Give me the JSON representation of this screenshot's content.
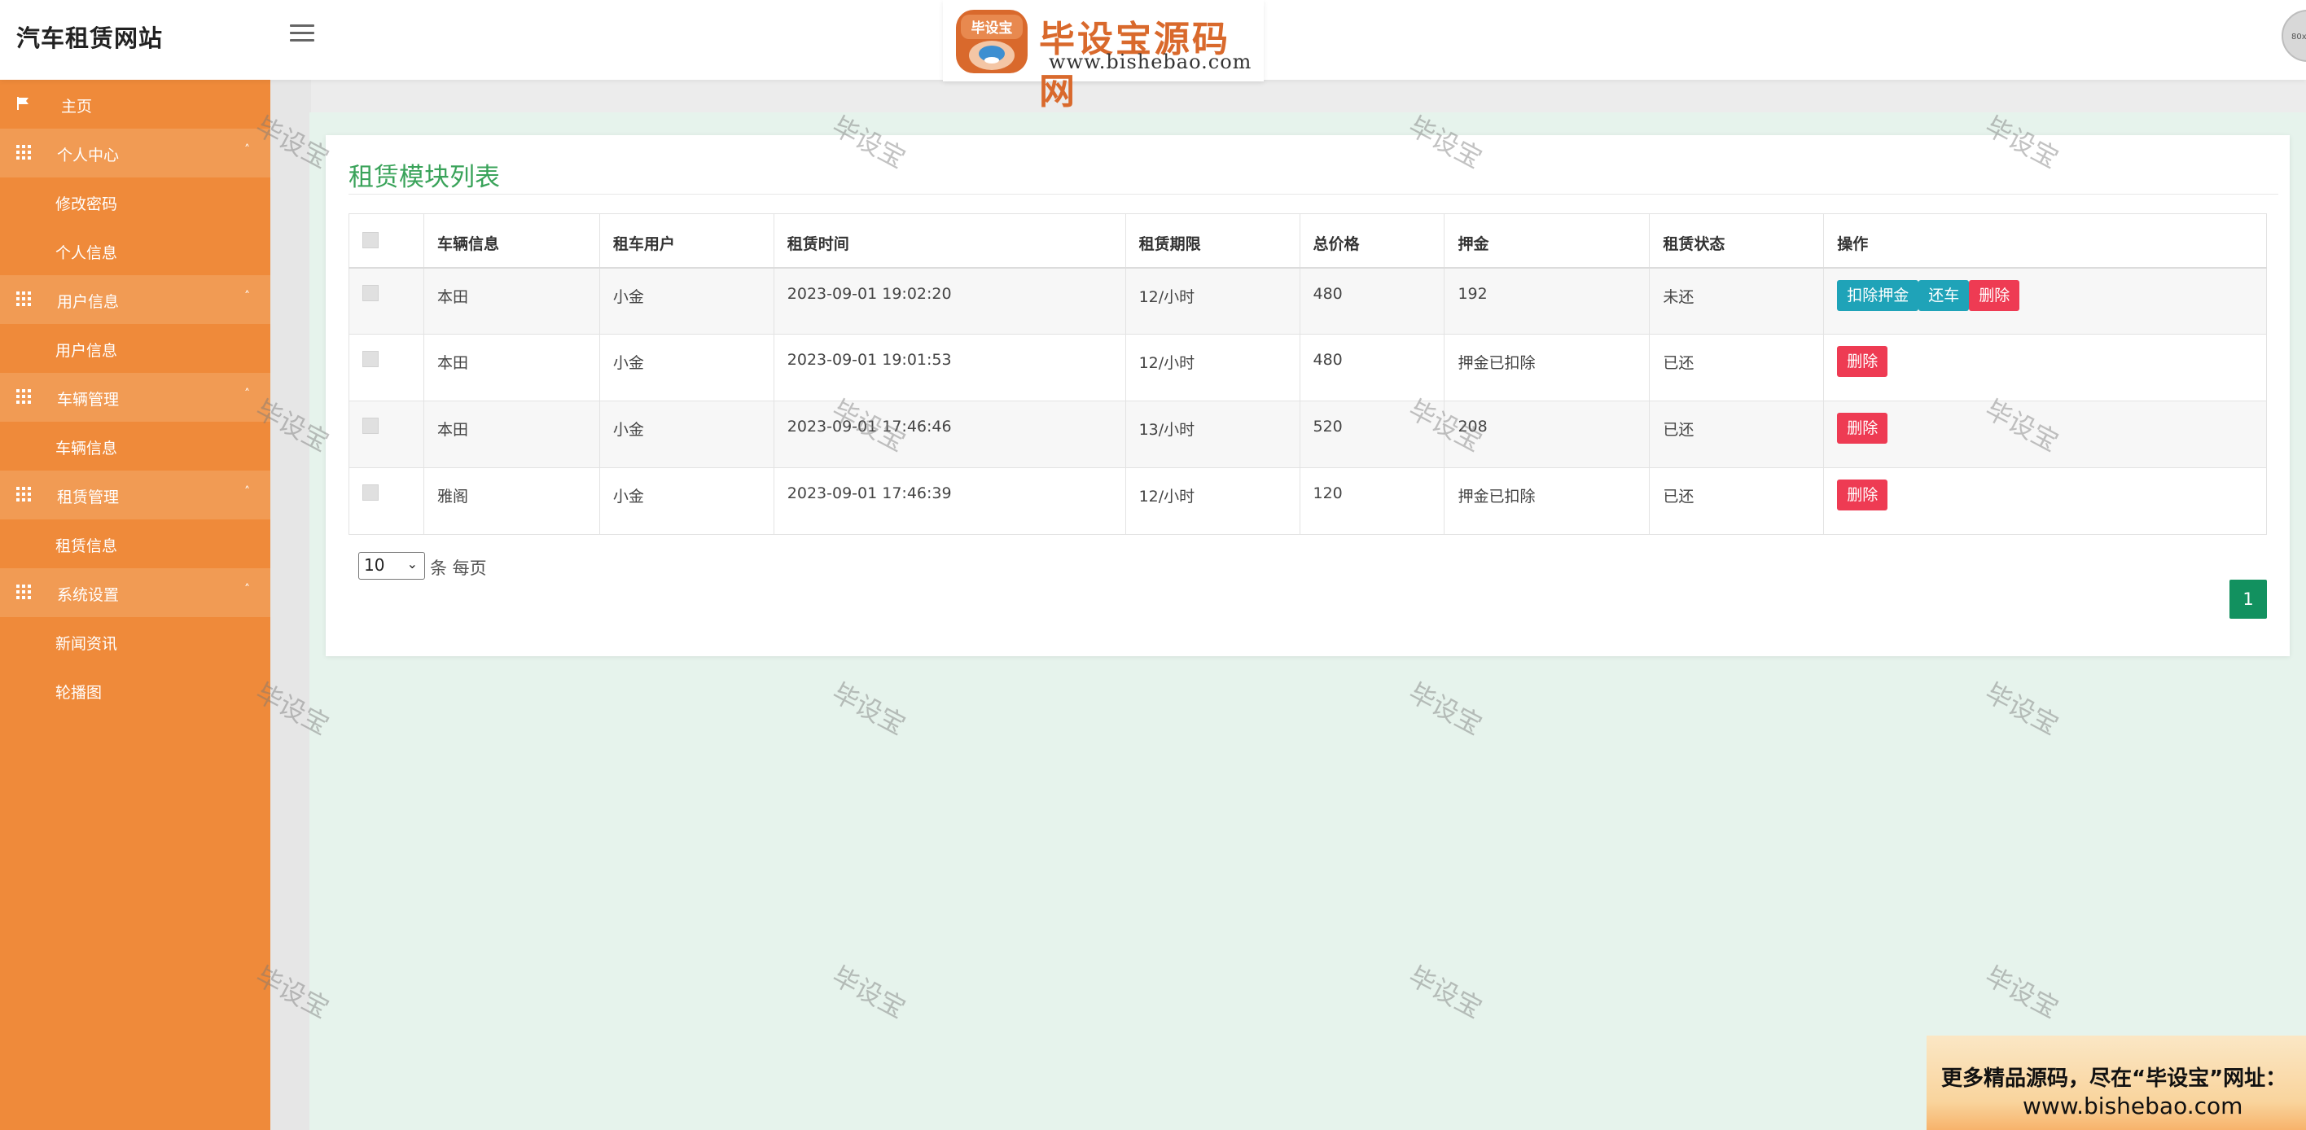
{
  "header": {
    "brand": "汽车租赁网站",
    "avatar_text": "80x"
  },
  "logo": {
    "badge": "毕设宝",
    "title": "毕设宝源码网",
    "url": "www.bishebao.com"
  },
  "sidebar": {
    "items": [
      {
        "label": "主页",
        "icon": "flag-icon",
        "type": "home"
      },
      {
        "label": "个人中心",
        "icon": "grid-icon",
        "type": "parent"
      },
      {
        "label": "修改密码",
        "type": "child"
      },
      {
        "label": "个人信息",
        "type": "child"
      },
      {
        "label": "用户信息",
        "icon": "grid-icon",
        "type": "parent"
      },
      {
        "label": "用户信息",
        "type": "child"
      },
      {
        "label": "车辆管理",
        "icon": "grid-icon",
        "type": "parent"
      },
      {
        "label": "车辆信息",
        "type": "child"
      },
      {
        "label": "租赁管理",
        "icon": "grid-icon",
        "type": "parent"
      },
      {
        "label": "租赁信息",
        "type": "child"
      },
      {
        "label": "系统设置",
        "icon": "grid-icon",
        "type": "parent"
      },
      {
        "label": "新闻资讯",
        "type": "child"
      },
      {
        "label": "轮播图",
        "type": "child"
      }
    ]
  },
  "main": {
    "title": "租赁模块列表",
    "table": {
      "columns": [
        "车辆信息",
        "租车用户",
        "租赁时间",
        "租赁期限",
        "总价格",
        "押金",
        "租赁状态",
        "操作"
      ],
      "rows": [
        {
          "vehicle": "本田",
          "user": "小金",
          "time": "2023-09-01 19:02:20",
          "period": "12/小时",
          "total": "480",
          "deposit": "192",
          "status": "未还",
          "actions": [
            "扣除押金",
            "还车",
            "删除"
          ]
        },
        {
          "vehicle": "本田",
          "user": "小金",
          "time": "2023-09-01 19:01:53",
          "period": "12/小时",
          "total": "480",
          "deposit": "押金已扣除",
          "status": "已还",
          "actions": [
            "删除"
          ]
        },
        {
          "vehicle": "本田",
          "user": "小金",
          "time": "2023-09-01 17:46:46",
          "period": "13/小时",
          "total": "520",
          "deposit": "208",
          "status": "已还",
          "actions": [
            "删除"
          ]
        },
        {
          "vehicle": "雅阁",
          "user": "小金",
          "time": "2023-09-01 17:46:39",
          "period": "12/小时",
          "total": "120",
          "deposit": "押金已扣除",
          "status": "已还",
          "actions": [
            "删除"
          ]
        }
      ]
    },
    "pagination": {
      "page_size": "10",
      "page_size_label": "条 每页",
      "current_page": "1"
    }
  },
  "watermark": "毕设宝",
  "promo": {
    "line1": "更多精品源码，尽在“毕设宝”网址：",
    "line2": "www.bishebao.com"
  },
  "colors": {
    "sidebar": "#ef8a3a",
    "sidebar_parent": "#f19b54",
    "title_green": "#3aa35a",
    "btn_teal": "#1fa3b8",
    "btn_red": "#ee3b53",
    "page_green": "#12915f",
    "content_bg": "#e6f3ec"
  }
}
